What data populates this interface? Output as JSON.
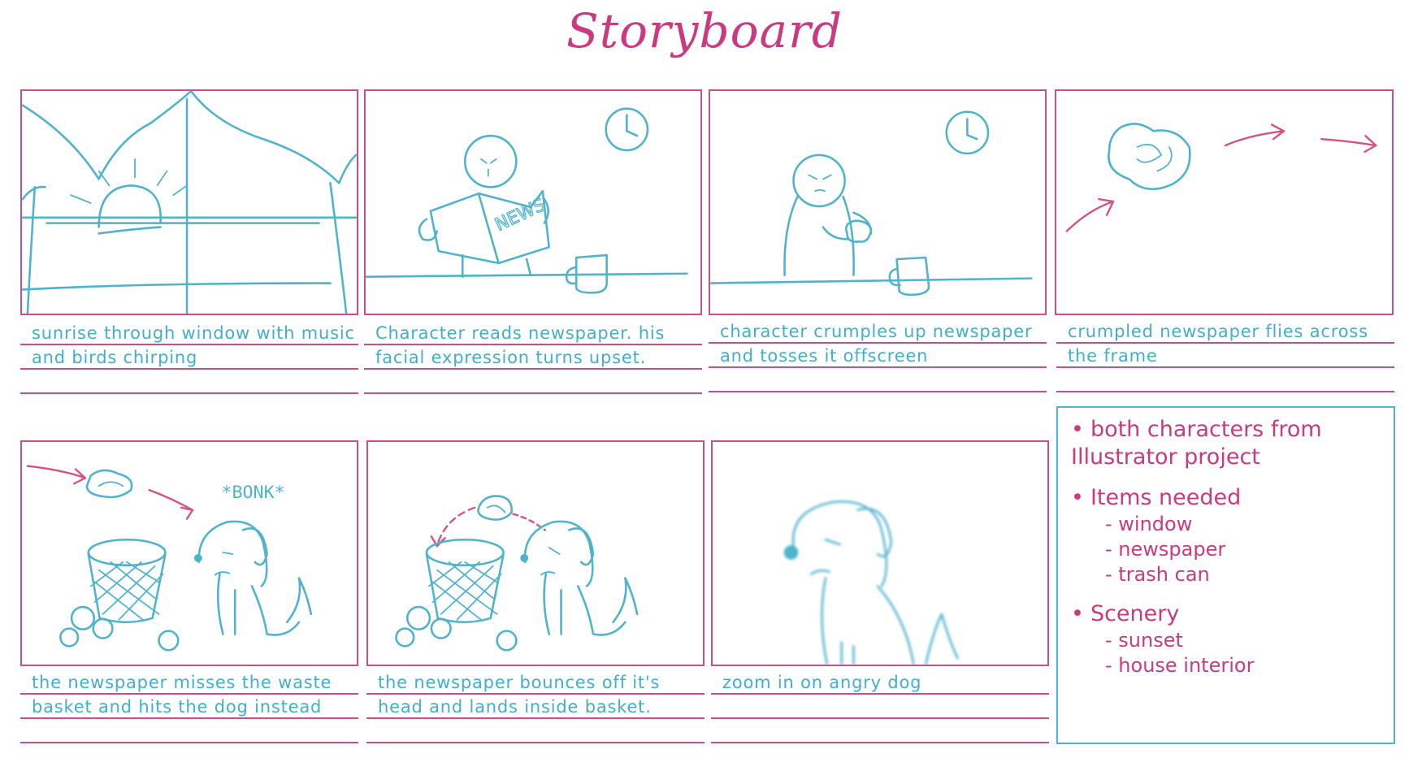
{
  "title": "Storyboard",
  "panels": [
    {
      "caption": "sunrise through window with music and birds chirping"
    },
    {
      "caption": "Character reads newspaper. his facial expression turns upset."
    },
    {
      "caption": "character crumples up newspaper and tosses it offscreen"
    },
    {
      "caption": "crumpled newspaper flies across the frame"
    },
    {
      "caption": "the newspaper misses the waste basket and hits the dog instead",
      "sound_effect": "*BONK*"
    },
    {
      "caption": "the newspaper bounces off it's head and lands inside basket."
    },
    {
      "caption": "zoom in on angry dog"
    }
  ],
  "newspaper_label": "NEWS",
  "notes": [
    {
      "text": "both characters from Illustrator project",
      "items": []
    },
    {
      "text": "Items needed",
      "items": [
        "window",
        "newspaper",
        "trash can"
      ]
    },
    {
      "text": "Scenery",
      "items": [
        "sunset",
        "house interior"
      ]
    }
  ],
  "colors": {
    "pink": "#c93b7e",
    "blue": "#4fb3cc"
  }
}
